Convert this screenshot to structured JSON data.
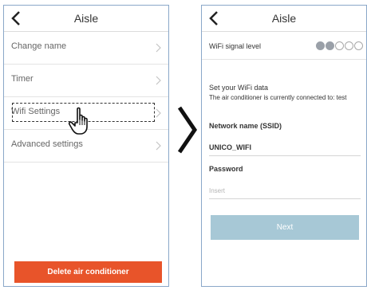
{
  "left_screen": {
    "title": "Aisle",
    "menu": [
      {
        "label": "Change name"
      },
      {
        "label": "Timer"
      },
      {
        "label": "Wifi Settings"
      },
      {
        "label": "Advanced settings"
      }
    ],
    "delete_button": "Delete air conditioner",
    "colors": {
      "delete_button": "#e8542a"
    }
  },
  "right_screen": {
    "title": "Aisle",
    "wifi_signal_label": "WiFi signal level",
    "wifi_signal_level": 2,
    "wifi_signal_max": 5,
    "set_wifi_heading": "Set your WiFi data",
    "connected_text": "The air conditioner is currently connected to: test",
    "network_label": "Network name (SSID)",
    "network_value": "UNICO_WIFI",
    "password_label": "Password",
    "password_placeholder": "Insert",
    "next_button": "Next",
    "colors": {
      "next_button": "#a7c8d6"
    }
  }
}
